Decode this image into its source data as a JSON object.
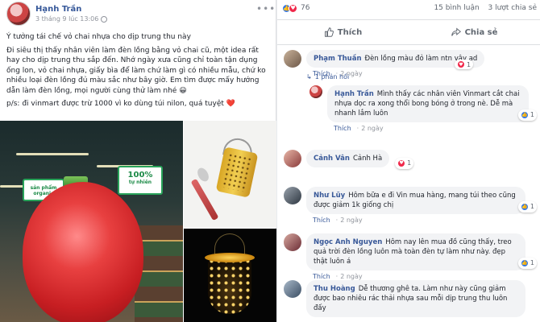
{
  "post": {
    "author": "Hạnh Trần",
    "time": "3 tháng 9 lúc 13:06",
    "title": "Ý tưởng tái chế vỏ chai nhựa cho dịp trung thu này",
    "body": "Đi siêu thị thấy nhân viên làm đèn lồng bằng vỏ chai cũ, một idea rất hay cho dịp trung thu sắp đến. Nhớ ngày xưa cũng chỉ toàn tận dụng ống lon, vỏ chai nhựa, giấy bìa để làm chứ làm gì có nhiều mẫu, chứ ko nhiều loại đèn lồng đủ màu sắc như bây giờ. Em tìm được mấy hướng dẫn làm đèn lồng, mọi người cùng thử làm nhé 😀",
    "ps": "p/s: đi vinmart được trừ 1000 vì ko dùng túi nilon, quá tuyệt ❤️",
    "more_icon": "more-dots-icon",
    "privacy_icon": "globe-icon",
    "sign1": "sản phẩm organic",
    "sign2_num": "100%",
    "sign2_txt": "tự nhiên"
  },
  "stats": {
    "reaction_count": "76",
    "comments": "15 bình luận",
    "shares": "3 lượt chia sẻ"
  },
  "actions": {
    "like": "Thích",
    "share": "Chia sẻ"
  },
  "comments": [
    {
      "author": "Phạm Thuần",
      "text": "Đèn lồng màu đỏ làm ntn vậy ad",
      "like": "Thích",
      "time": "2 ngày",
      "reactions": "1",
      "reply_label": "1 phản hồi",
      "reply": {
        "author": "Hạnh Trần",
        "text": "Mình thấy các nhân viên Vinmart cắt chai nhựa dọc ra xong thổi bong bóng ở trong nè. Dễ mà nhanh lắm luôn",
        "like": "Thích",
        "time": "2 ngày",
        "reactions": "1"
      }
    },
    {
      "author": "Cảnh Vân",
      "text": "Cảnh Hà",
      "reactions": "1"
    },
    {
      "author": "Như Lũy",
      "text": "Hôm bữa e đi Vin mua hàng, mang túi theo cũng được giảm 1k giống chị",
      "like": "Thích",
      "time": "2 ngày",
      "reactions": "1"
    },
    {
      "author": "Ngọc Anh Nguyen",
      "text": "Hôm nay lên mua đồ cũng thấy, treo quả trời đèn lồng luôn mà toàn đèn tự làm như này. đẹp thật luôn á",
      "like": "Thích",
      "time": "2 ngày",
      "reactions": "1"
    },
    {
      "author": "Thu Hoàng",
      "text": "Dễ thương ghê ta. Làm như này cũng giảm được bao nhiêu rác thải nhựa sau mỗi dịp trung thu luôn đấy"
    }
  ],
  "colors": {
    "link": "#385898",
    "like": "#3578e5",
    "love": "#f0284a"
  }
}
